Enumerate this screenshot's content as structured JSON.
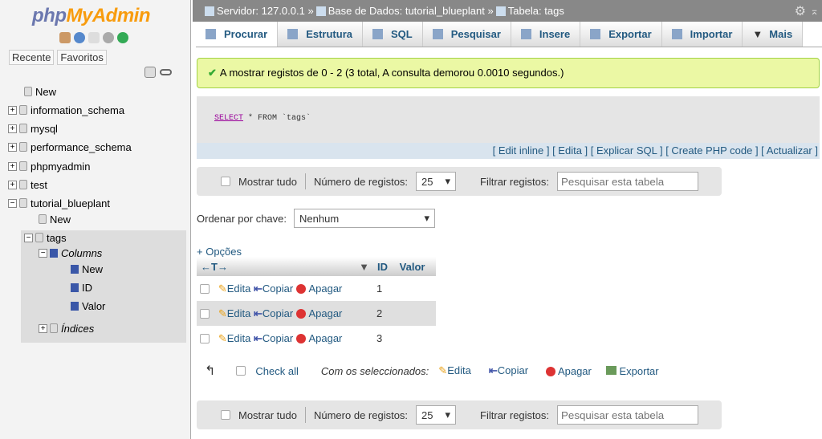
{
  "sidebar": {
    "logo_php": "php",
    "logo_myadmin": "MyAdmin",
    "tabs": [
      "Recente",
      "Favoritos"
    ],
    "tree": [
      {
        "label": "New"
      },
      {
        "label": "information_schema"
      },
      {
        "label": "mysql"
      },
      {
        "label": "performance_schema"
      },
      {
        "label": "phpmyadmin"
      },
      {
        "label": "test"
      },
      {
        "label": "tutorial_blueplant"
      },
      {
        "label": "New"
      },
      {
        "label": "tags"
      },
      {
        "label": "Columns"
      },
      {
        "label": "New"
      },
      {
        "label": "ID"
      },
      {
        "label": "Valor"
      },
      {
        "label": "Índices"
      }
    ]
  },
  "breadcrumb": {
    "server": "Servidor: 127.0.0.1",
    "db": "Base de Dados: tutorial_blueplant",
    "table": "Tabela: tags",
    "sep": "»"
  },
  "tabs": [
    "Procurar",
    "Estrutura",
    "SQL",
    "Pesquisar",
    "Insere",
    "Exportar",
    "Importar",
    "Mais"
  ],
  "message": "A mostrar registos de 0 - 2 (3 total, A consulta demorou 0.0010 segundos.)",
  "query": {
    "select": "SELECT",
    "rest": " * FROM `tags`"
  },
  "query_links": "[ Edit inline ] [ Edita ] [ Explicar SQL ] [ Create PHP code ] [ Actualizar ]",
  "nav": {
    "show_all": "Mostrar tudo",
    "rows_label": "Número de registos:",
    "rows_value": "25",
    "filter_label": "Filtrar registos:",
    "filter_placeholder": "Pesquisar esta tabela"
  },
  "sort": {
    "label": "Ordenar por chave:",
    "value": "Nenhum"
  },
  "options": "+ Opções",
  "columns": [
    "ID",
    "Valor"
  ],
  "rows": [
    {
      "id": "1",
      "valor": ""
    },
    {
      "id": "2",
      "valor": ""
    },
    {
      "id": "3",
      "valor": ""
    }
  ],
  "actions": {
    "edit": "Edita",
    "copy": "Copiar",
    "delete": "Apagar",
    "export": "Exportar"
  },
  "bottom": {
    "check_all": "Check all",
    "with_selected": "Com os seleccionados:"
  }
}
